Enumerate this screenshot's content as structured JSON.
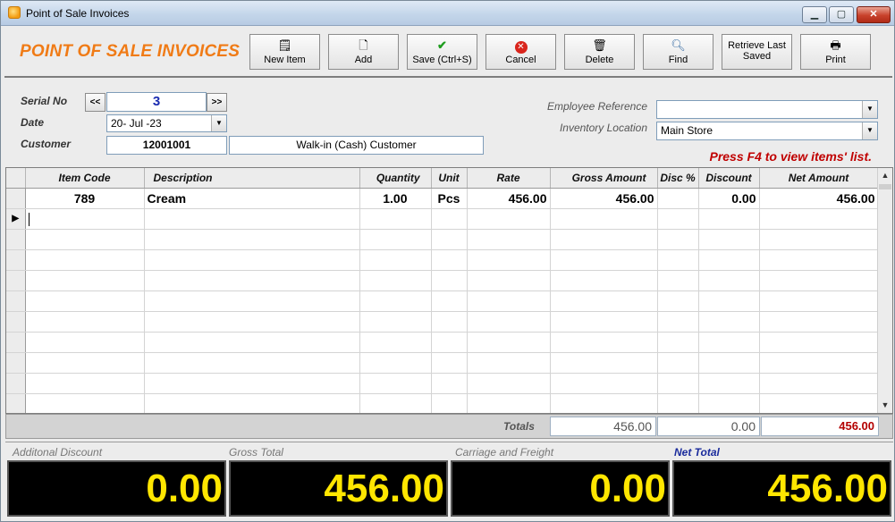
{
  "window": {
    "title": "Point of Sale Invoices"
  },
  "header": {
    "title": "POINT OF SALE INVOICES"
  },
  "toolbar": {
    "new_item": "New Item",
    "add": "Add",
    "save": "Save (Ctrl+S)",
    "cancel": "Cancel",
    "delete": "Delete",
    "find": "Find",
    "retrieve": "Retrieve Last\nSaved",
    "print": "Print"
  },
  "form": {
    "serial_label": "Serial No",
    "serial_value": "3",
    "prev": "<<",
    "next": ">>",
    "date_label": "Date",
    "date_value": "20- Jul -23",
    "customer_label": "Customer",
    "customer_code": "12001001",
    "customer_name": "Walk-in (Cash) Customer",
    "employee_label": "Employee Reference",
    "employee_value": "",
    "location_label": "Inventory Location",
    "location_value": "Main Store",
    "hint": "Press F4 to view items' list."
  },
  "grid": {
    "columns": [
      "Item Code",
      "Description",
      "Quantity",
      "Unit",
      "Rate",
      "Gross Amount",
      "Disc %",
      "Discount",
      "Net Amount"
    ],
    "rows": [
      {
        "code": "789",
        "description": "Cream",
        "quantity": "1.00",
        "unit": "Pcs",
        "rate": "456.00",
        "gross": "456.00",
        "disc_pct": "",
        "discount": "0.00",
        "net": "456.00"
      }
    ]
  },
  "totals": {
    "label": "Totals",
    "gross": "456.00",
    "discount": "0.00",
    "net": "456.00"
  },
  "bottom": {
    "additional_discount_label": "Additonal Discount",
    "additional_discount": "0.00",
    "gross_total_label": "Gross Total",
    "gross_total": "456.00",
    "carriage_label": "Carriage and Freight",
    "carriage": "0.00",
    "net_total_label": "Net Total",
    "net_total": "456.00"
  },
  "colors": {
    "heading": "#f07b16",
    "hint": "#c00000",
    "panel_text": "#ffe600",
    "panel_bg": "#000000"
  }
}
